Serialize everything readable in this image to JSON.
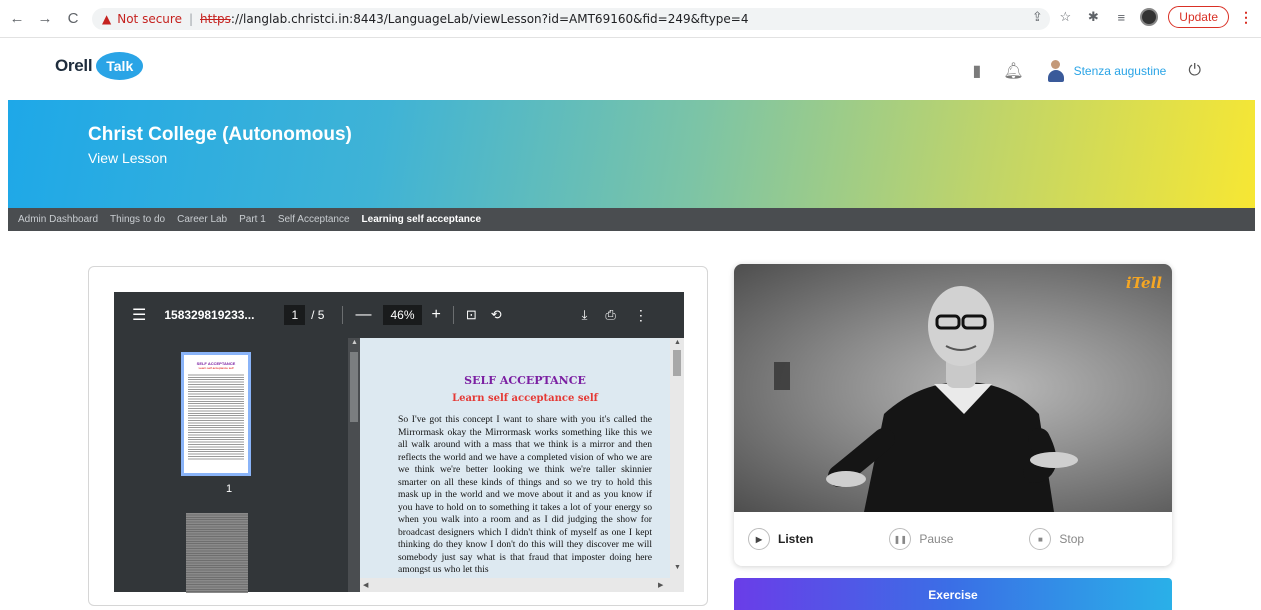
{
  "browser": {
    "back": "←",
    "forward": "→",
    "reload": "C",
    "security_label": "Not secure",
    "url_scheme": "https",
    "url_rest": "://langlab.christci.in:8443/LanguageLab/viewLesson?id=AMT69160&fid=249&ftype=4",
    "update_label": "Update"
  },
  "header": {
    "logo_word": "Orell",
    "logo_badge": "Talk",
    "user_name": "Stenza augustine"
  },
  "banner": {
    "title": "Christ College (Autonomous)",
    "subtitle": "View Lesson"
  },
  "breadcrumb": [
    "Admin Dashboard",
    "Things to do",
    "Career Lab",
    "Part 1",
    "Self Acceptance",
    "Learning self acceptance"
  ],
  "pdf": {
    "file_name": "158329819233...",
    "current_page": "1",
    "total_pages": "/ 5",
    "zoom": "46%",
    "thumb_page_number": "1",
    "thumb_title": "SELF ACCEPTANCE",
    "thumb_subtitle": "Learn self acceptance self",
    "page_title": "SELF ACCEPTANCE",
    "page_subtitle": "Learn self acceptance self",
    "page_text": "So I've got this concept I want to share with you it's called the Mirrormask okay the Mirrormask works something like this we all walk around with a mass that we think is a mirror and then reflects the world and we have a completed vision of who we are we think we're better looking we think we're taller skinnier smarter on all these kinds of things and so we try to hold this mask up in the world and we move about it and as you know if you have to hold on to something it takes a lot of your energy so when you walk into a room and as I did judging the show for broadcast designers which I didn't think of myself as one I kept thinking do they know I don't do this will they discover me will somebody just say what is that fraud that imposter doing here amongst us who let this"
  },
  "video": {
    "logo": "iTell",
    "listen_label": "Listen",
    "pause_label": "Pause",
    "stop_label": "Stop"
  },
  "exercise_label": "Exercise",
  "colors": {
    "accent_blue": "#2aa4e6",
    "breadcrumb_bg": "#4a4d50",
    "pdf_title": "#7b1fa2",
    "pdf_subtitle": "#e53935"
  }
}
